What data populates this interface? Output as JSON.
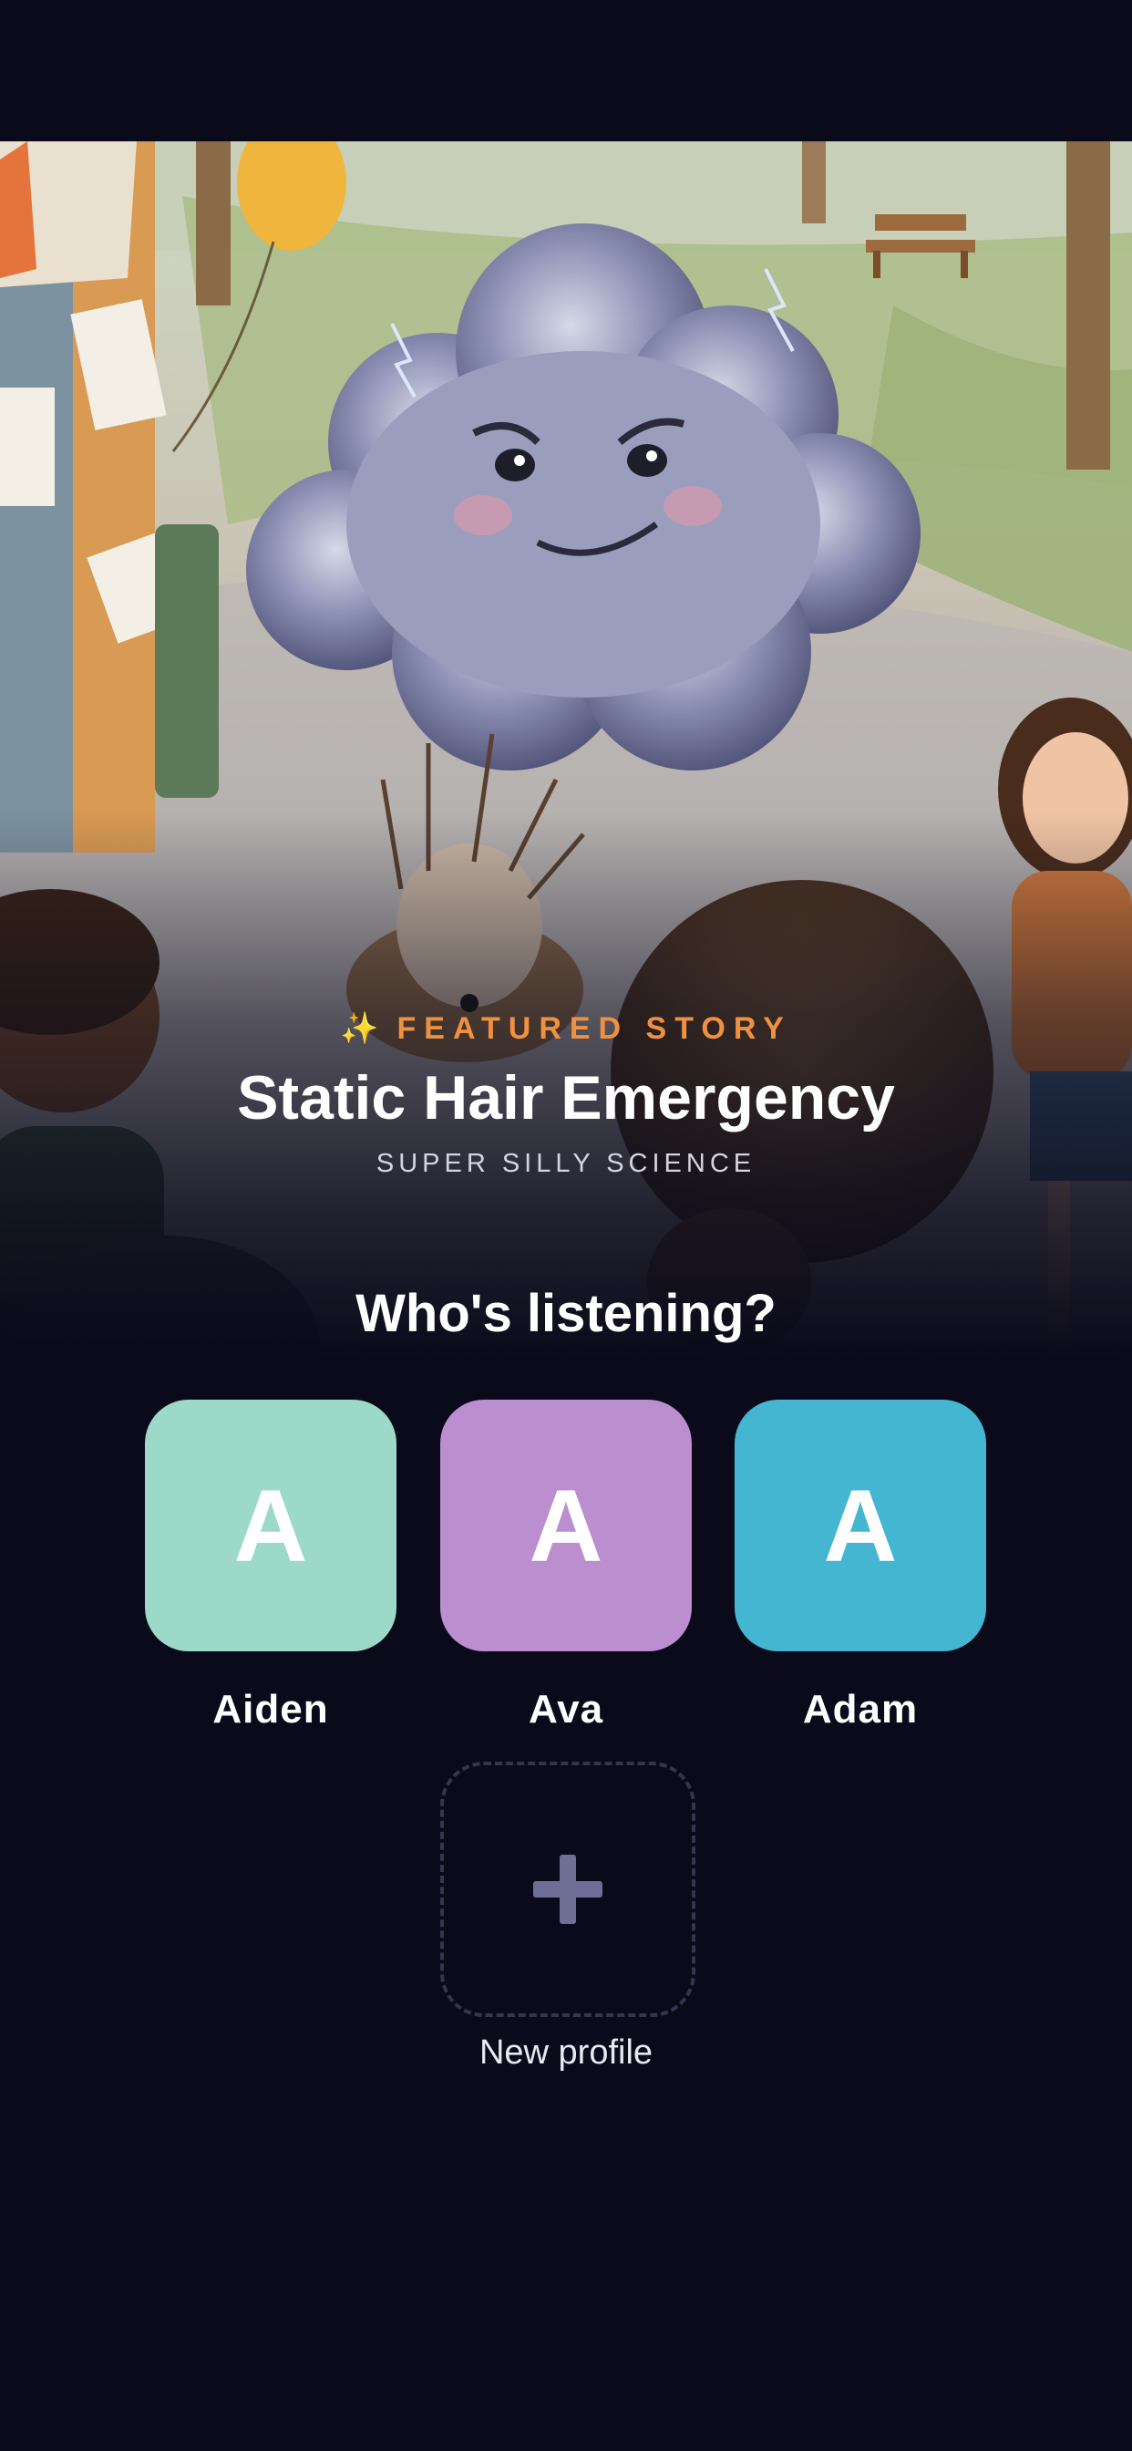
{
  "featured": {
    "label": "FEATURED STORY",
    "sparkle": "✨",
    "title": "Static Hair Emergency",
    "category": "SUPER SILLY SCIENCE"
  },
  "prompt": "Who's listening?",
  "profiles": [
    {
      "initial": "A",
      "name": "Aiden",
      "color": "#9dd9c8"
    },
    {
      "initial": "A",
      "name": "Ava",
      "color": "#bb8ecf"
    },
    {
      "initial": "A",
      "name": "Adam",
      "color": "#45b6d2"
    }
  ],
  "new_profile": {
    "label": "New profile",
    "icon": "plus-icon"
  },
  "colors": {
    "background": "#0a0a1a",
    "accent": "#f0913f",
    "plus": "#6e6e96"
  }
}
